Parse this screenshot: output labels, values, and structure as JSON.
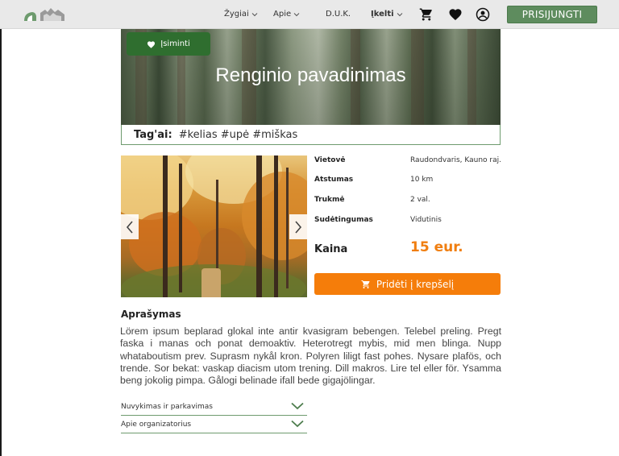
{
  "nav": {
    "items": [
      {
        "label": "Žygiai"
      },
      {
        "label": "Apie"
      },
      {
        "label": "D.U.K."
      },
      {
        "label": "Įkelti"
      }
    ],
    "login_label": "PRISIJUNGTI",
    "icons": [
      "logo-icon",
      "cart-icon",
      "heart-icon",
      "user-icon"
    ]
  },
  "hero": {
    "remember_label": "Įsiminti",
    "title": "Renginio pavadinimas"
  },
  "tags": {
    "label": "Tag'ai:",
    "value": "#kelias #upė #miškas"
  },
  "details": {
    "rows": [
      {
        "label": "Vietovė",
        "value": "Raudondvaris, Kauno raj."
      },
      {
        "label": "Atstumas",
        "value": "10 km"
      },
      {
        "label": "Trukmė",
        "value": "2 val."
      },
      {
        "label": "Sudėtingumas",
        "value": "Vidutinis"
      }
    ],
    "price_label": "Kaina",
    "price_value": "15 eur.",
    "cart_button_label": "Pridėti į krepšelį"
  },
  "description": {
    "title": "Aprašymas",
    "text": "Lörem ipsum beplarad glokal inte antir kvasigram bebengen. Telebel preling. Pregt faska i manas och ponat demoaktiv. Heterotregt mybis, mid men blinga. Nupp whataboutism prev. Suprasm nykål kron. Polyren liligt fast pohes. Nysare plafös, och trende. Sor bekat: vaskap diacism utom trening. Dill makros. Lire tel eller för. Ysamma beng jokolig pimpa. Gålogi belinade ifall bede gigajölingar."
  },
  "accordion": [
    {
      "label": "Nuvykimas ir parkavimas"
    },
    {
      "label": "Apie organizatorius"
    }
  ],
  "colors": {
    "accent_green": "#5e8c5e",
    "dark_green": "#2f6e2f",
    "orange": "#f57d0a",
    "price_orange": "#f07e10"
  }
}
